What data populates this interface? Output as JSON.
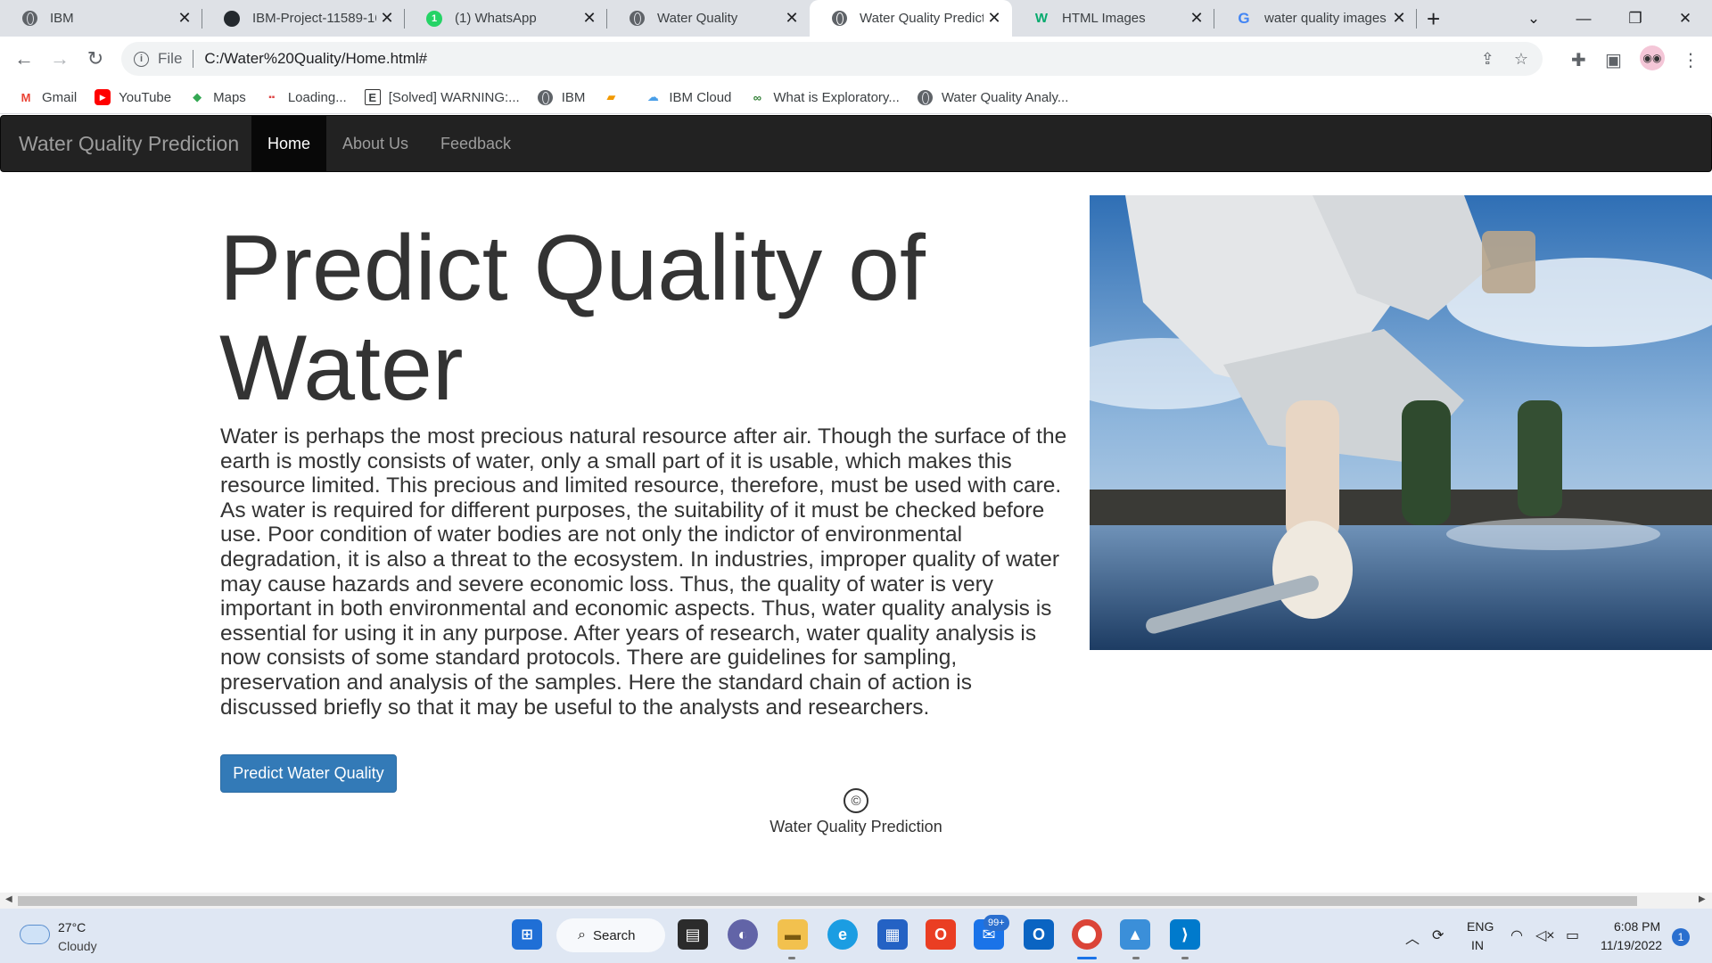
{
  "browser": {
    "tabs": [
      {
        "title": "IBM",
        "icon": "globe-icon"
      },
      {
        "title": "IBM-Project-11589-16",
        "icon": "github-icon"
      },
      {
        "title": "(1) WhatsApp",
        "icon": "whatsapp-icon"
      },
      {
        "title": "Water Quality",
        "icon": "globe-icon"
      },
      {
        "title": "Water Quality Predicti",
        "icon": "globe-icon"
      },
      {
        "title": "HTML Images",
        "icon": "w3schools-icon"
      },
      {
        "title": "water quality images",
        "icon": "google-icon"
      }
    ],
    "active_tab": 4,
    "new_tab": "+",
    "address": {
      "scheme_label": "File",
      "url": "C:/Water%20Quality/Home.html#"
    },
    "bookmarks": [
      {
        "label": "Gmail",
        "icon": "gmail-icon"
      },
      {
        "label": "YouTube",
        "icon": "youtube-icon"
      },
      {
        "label": "Maps",
        "icon": "maps-icon"
      },
      {
        "label": "Loading...",
        "icon": "loading-icon"
      },
      {
        "label": "[Solved] WARNING:...",
        "icon": "e-icon"
      },
      {
        "label": "IBM",
        "icon": "globe-icon"
      },
      {
        "label": "",
        "icon": "bookmark-icon"
      },
      {
        "label": "IBM Cloud",
        "icon": "cloud-icon"
      },
      {
        "label": "What is Exploratory...",
        "icon": "link-icon"
      },
      {
        "label": "Water Quality Analy...",
        "icon": "globe-icon"
      }
    ]
  },
  "site": {
    "brand": "Water Quality Prediction",
    "nav": [
      "Home",
      "About Us",
      "Feedback"
    ],
    "active_nav": 0,
    "headline": "Predict Quality of Water",
    "paragraph": "Water is perhaps the most precious natural resource after air. Though the surface of the earth is mostly consists of water, only a small part of it is usable, which makes this resource limited. This precious and limited resource, therefore, must be used with care. As water is required for different purposes, the suitability of it must be checked before use. Poor condition of water bodies are not only the indictor of environmental degradation, it is also a threat to the ecosystem. In industries, improper quality of water may cause hazards and severe economic loss. Thus, the quality of water is very important in both environmental and economic aspects. Thus, water quality analysis is essential for using it in any purpose. After years of research, water quality analysis is now consists of some standard protocols. There are guidelines for sampling, preservation and analysis of the samples. Here the standard chain of action is discussed briefly so that it may be useful to the analysts and researchers.",
    "cta": "Predict Water Quality",
    "footer_symbol": "©",
    "footer_text": "Water Quality Prediction"
  },
  "taskbar": {
    "weather_temp": "27°C",
    "weather_cond": "Cloudy",
    "search_label": "Search",
    "mail_badge": "99+",
    "lang_top": "ENG",
    "lang_bottom": "IN",
    "time": "6:08 PM",
    "date": "11/19/2022",
    "notifications": "1"
  },
  "colors": {
    "navbar_bg": "#222222",
    "navbar_active": "#080808",
    "button_primary": "#337ab7",
    "text": "#333333"
  }
}
